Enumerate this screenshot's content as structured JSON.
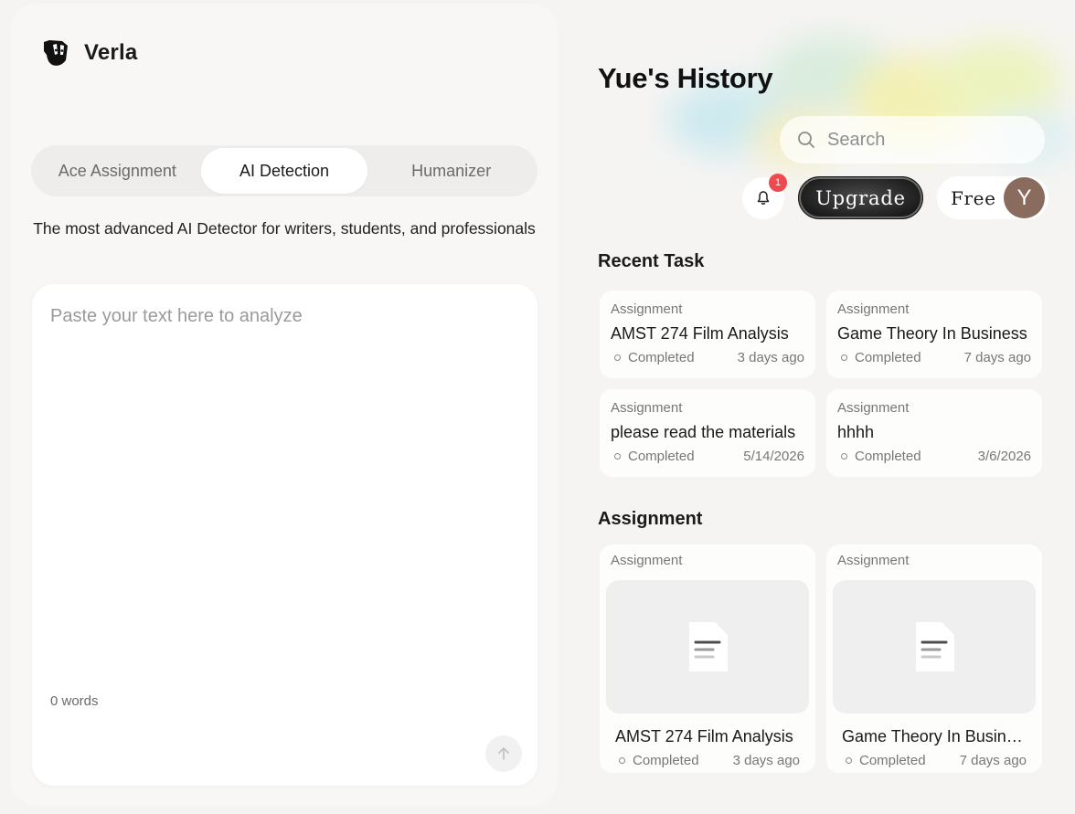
{
  "brand": {
    "name": "Verla",
    "logo_icon": "mascot-logo-icon"
  },
  "tabs": [
    {
      "label": "Ace Assignment",
      "active": false
    },
    {
      "label": "AI Detection",
      "active": true
    },
    {
      "label": "Humanizer",
      "active": false
    }
  ],
  "tagline": "The most advanced AI Detector for writers, students, and professionals",
  "editor": {
    "placeholder": "Paste your text here to analyze",
    "value": "",
    "word_count": "0 words",
    "submit_icon": "arrow-up-icon"
  },
  "history": {
    "title": "Yue's History",
    "search": {
      "placeholder": "Search",
      "icon": "search-icon"
    },
    "notifications": {
      "count": "1",
      "icon": "bell-icon"
    },
    "upgrade_label": "Upgrade",
    "plan_label": "Free",
    "avatar_initial": "Y"
  },
  "recent": {
    "heading": "Recent Task",
    "items": [
      {
        "type": "Assignment",
        "title": "AMST 274 Film Analysis",
        "status": "Completed",
        "date": "3 days ago"
      },
      {
        "type": "Assignment",
        "title": "Game Theory In Business",
        "status": "Completed",
        "date": "7 days ago"
      },
      {
        "type": "Assignment",
        "title": "please read the materials",
        "status": "Completed",
        "date": "5/14/2026"
      },
      {
        "type": "Assignment",
        "title": "hhhh",
        "status": "Completed",
        "date": "3/6/2026"
      }
    ]
  },
  "assignments": {
    "heading": "Assignment",
    "items": [
      {
        "type": "Assignment",
        "title": "AMST 274 Film Analysis",
        "status": "Completed",
        "date": "3 days ago",
        "thumb_icon": "document-icon"
      },
      {
        "type": "Assignment",
        "title": "Game Theory In Business",
        "status": "Completed",
        "date": "7 days ago",
        "thumb_icon": "document-icon"
      }
    ]
  },
  "colors": {
    "background": "#f5f4f2",
    "panel": "#f8f7f5",
    "badge": "#ec4a4f",
    "avatar": "#8a6c5e",
    "upgrade_button": "#1b1b1b"
  }
}
